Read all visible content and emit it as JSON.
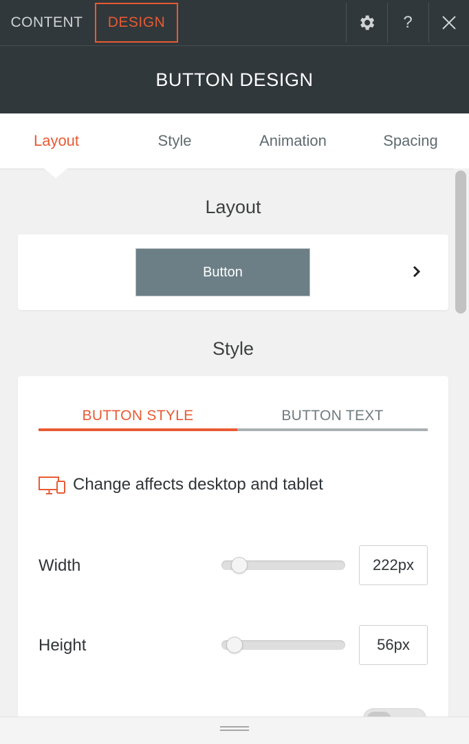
{
  "top_tabs": {
    "content": "CONTENT",
    "design": "DESIGN"
  },
  "top_icons": {
    "settings": "gear-icon",
    "help": "?",
    "close": "close-icon"
  },
  "panel_title": "BUTTON DESIGN",
  "sub_tabs": [
    {
      "label": "Layout",
      "active": true
    },
    {
      "label": "Style",
      "active": false
    },
    {
      "label": "Animation",
      "active": false
    },
    {
      "label": "Spacing",
      "active": false
    }
  ],
  "layout_section": {
    "title": "Layout",
    "preview_button_label": "Button"
  },
  "style_section": {
    "title": "Style",
    "tabs": [
      {
        "label": "BUTTON STYLE",
        "active": true
      },
      {
        "label": "BUTTON TEXT",
        "active": false
      }
    ],
    "device_note": "Change affects desktop and tablet",
    "width": {
      "label": "Width",
      "value": "222px",
      "slider_level": 0.12
    },
    "height": {
      "label": "Height",
      "value": "56px",
      "slider_level": 0.07
    }
  },
  "colors": {
    "accent": "#e85a33",
    "header_bg": "#31383b",
    "preview_button_bg": "#6c7f86"
  }
}
